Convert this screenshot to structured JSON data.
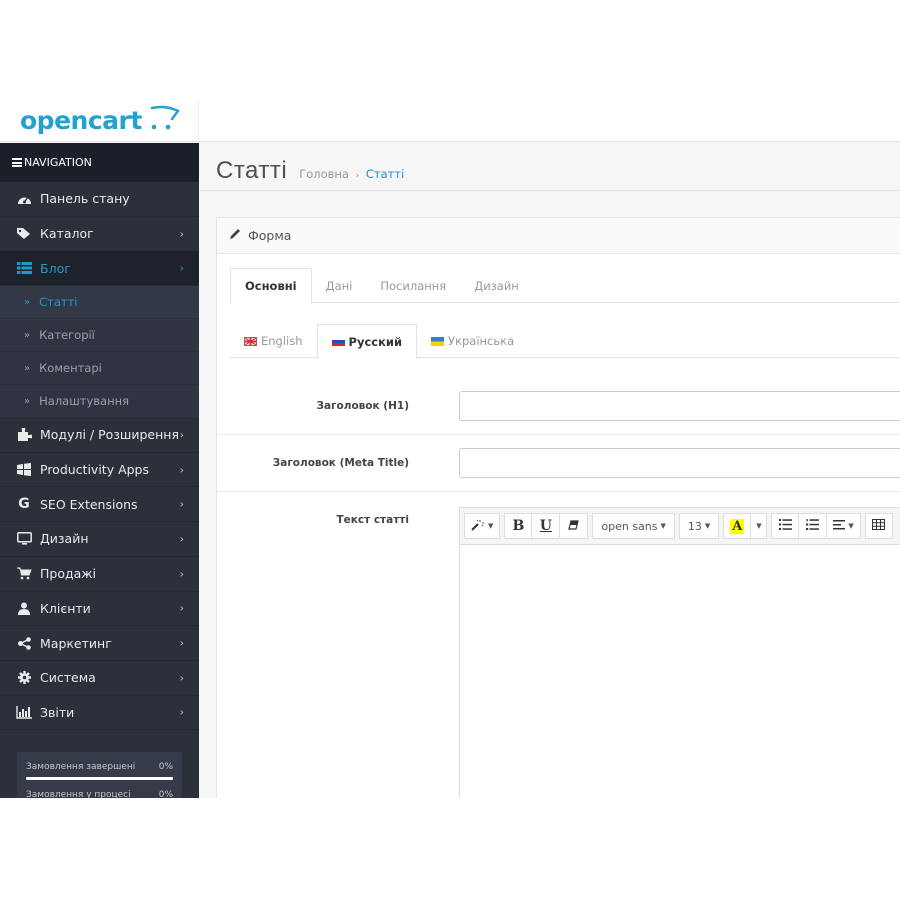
{
  "header": {
    "logo_text": "opencart",
    "brand_color": "#23a1d1"
  },
  "sidebar": {
    "nav_title": "NAVIGATION",
    "items": [
      {
        "label": "Панель стану",
        "icon": "dashboard-icon",
        "has_children": false
      },
      {
        "label": "Каталог",
        "icon": "tags-icon",
        "has_children": true
      },
      {
        "label": "Блог",
        "icon": "list-icon",
        "has_children": true,
        "active": true
      },
      {
        "label": "Модулі / Розширення",
        "icon": "puzzle-icon",
        "has_children": true
      },
      {
        "label": "Productivity Apps",
        "icon": "windows-icon",
        "has_children": true
      },
      {
        "label": "SEO Extensions",
        "icon": "google-icon",
        "has_children": true
      },
      {
        "label": "Дизайн",
        "icon": "monitor-icon",
        "has_children": true
      },
      {
        "label": "Продажі",
        "icon": "cart-icon",
        "has_children": true
      },
      {
        "label": "Клієнти",
        "icon": "user-icon",
        "has_children": true
      },
      {
        "label": "Маркетинг",
        "icon": "share-icon",
        "has_children": true
      },
      {
        "label": "Система",
        "icon": "gear-icon",
        "has_children": true
      },
      {
        "label": "Звіти",
        "icon": "bar-chart-icon",
        "has_children": true
      }
    ],
    "blog_sub_items": [
      {
        "label": "Статті",
        "active": true
      },
      {
        "label": "Категорії"
      },
      {
        "label": "Коментарі"
      },
      {
        "label": "Налаштування"
      }
    ],
    "stats": [
      {
        "label": "Замовлення завершені",
        "value": "0%",
        "progress": 0
      },
      {
        "label": "Замовлення у процесі",
        "value": "0%",
        "progress": 0
      }
    ]
  },
  "page": {
    "title": "Статті",
    "breadcrumb": [
      {
        "label": "Головна"
      },
      {
        "label": "Статті",
        "current": true
      }
    ]
  },
  "panel": {
    "title": "Форма",
    "tabs": [
      {
        "label": "Основні",
        "active": true
      },
      {
        "label": "Дані"
      },
      {
        "label": "Посилання"
      },
      {
        "label": "Дизайн"
      }
    ],
    "language_tabs": [
      {
        "label": "English",
        "flag": "uk"
      },
      {
        "label": "Русский",
        "flag": "ru",
        "active": true
      },
      {
        "label": "Українська",
        "flag": "ua"
      }
    ],
    "fields": {
      "h1_label": "Заголовок (H1)",
      "h1_value": "",
      "meta_title_label": "Заголовок (Meta Title)",
      "meta_title_value": "",
      "text_label": "Текст статті"
    },
    "editor_toolbar": {
      "font_name": "open sans",
      "font_size": "13",
      "color_letter": "A",
      "bold": "B",
      "underline": "U",
      "highlight_color": "#ffff00"
    }
  }
}
